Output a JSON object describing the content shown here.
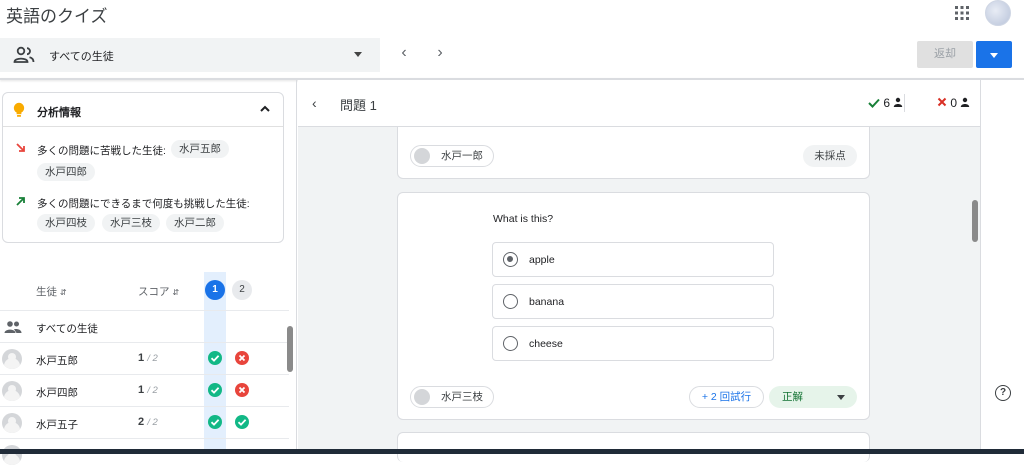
{
  "app": {
    "title": "英語のクイズ"
  },
  "toolbar": {
    "students_filter": "すべての生徒",
    "return_label": "返却",
    "prev_icon": "chevron-left-icon",
    "next_icon": "chevron-right-icon"
  },
  "insights": {
    "title": "分析情報",
    "struggled_label": "多くの問題に苦戦した生徒:",
    "struggled_students": [
      "水戸五郎",
      "水戸四郎"
    ],
    "persisted_label": "多くの問題にできるまで何度も挑戦した生徒:",
    "persisted_students": [
      "水戸四枝",
      "水戸三枝",
      "水戸二郎"
    ]
  },
  "table": {
    "col_student": "生徒",
    "col_score": "スコア",
    "questions": [
      "1",
      "2"
    ],
    "all_students": "すべての生徒",
    "rows": [
      {
        "name": "水戸五郎",
        "score": "1",
        "total": "/ 2",
        "q1": "correct",
        "q2": "incorrect"
      },
      {
        "name": "水戸四郎",
        "score": "1",
        "total": "/ 2",
        "q1": "correct",
        "q2": "incorrect"
      },
      {
        "name": "水戸五子",
        "score": "2",
        "total": "/ 2",
        "q1": "correct",
        "q2": "correct"
      }
    ]
  },
  "question": {
    "title": "問題 1",
    "correct_count": "6",
    "wrong_count": "0",
    "prev_response": {
      "student": "水戸一郎",
      "status": "未採点"
    },
    "prompt": "What is this?",
    "options": [
      "apple",
      "banana",
      "cheese"
    ],
    "selected_option": 0,
    "response": {
      "student": "水戸三枝",
      "attempts": "+ 2 回試行",
      "grade": "正解"
    }
  },
  "colors": {
    "accent": "#1a73e8",
    "correct": "#12b886",
    "incorrect": "#e8453c"
  }
}
